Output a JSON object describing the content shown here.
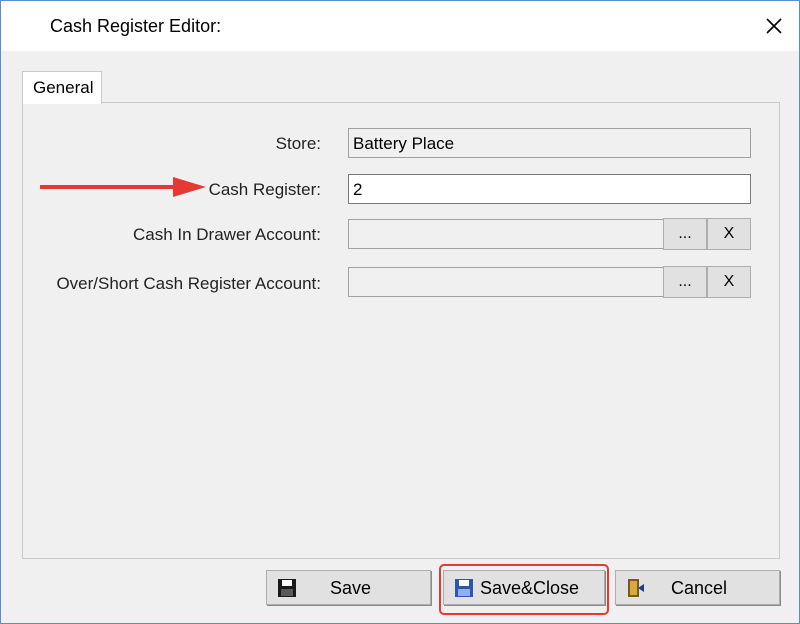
{
  "window": {
    "title": "Cash Register Editor:",
    "close_glyph": "✕"
  },
  "tabs": [
    {
      "label": "General",
      "active": true
    }
  ],
  "form": {
    "store": {
      "label": "Store:",
      "value": "Battery Place"
    },
    "cash_register": {
      "label": "Cash Register:",
      "value": "2"
    },
    "cash_in_drawer": {
      "label": "Cash In Drawer Account:",
      "value": "",
      "browse_label": "...",
      "clear_label": "X"
    },
    "over_short": {
      "label": "Over/Short Cash Register Account:",
      "value": "",
      "browse_label": "...",
      "clear_label": "X"
    }
  },
  "buttons": {
    "save": {
      "label": "Save",
      "icon": "floppy-disk-icon"
    },
    "save_close": {
      "label": "Save&Close",
      "icon": "floppy-disk-icon"
    },
    "cancel": {
      "label": "Cancel",
      "icon": "exit-door-icon"
    }
  },
  "colors": {
    "annotation_red": "#e53935",
    "save_close_icon": "#2f56b0",
    "window_border": "#5a8ccf"
  }
}
